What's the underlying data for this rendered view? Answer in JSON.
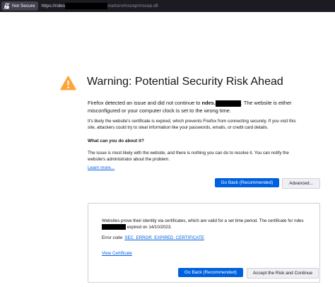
{
  "urlbar": {
    "security_label": "Not Secure",
    "url_prefix": "https://ndes",
    "url_suffix": "/certsrv/mscep/mscep.dll"
  },
  "warning": {
    "icon": "warning-triangle-icon",
    "title": "Warning: Potential Security Risk Ahead",
    "intro_before": "Firefox detected an issue and did not continue to ",
    "intro_host": "ndes.",
    "intro_after": ". The website is either misconfigured or your computer clock is set to the wrong time.",
    "detail": "It's likely the website's certificate is expired, which prevents Firefox from connecting securely. If you visit this site, attackers could try to steal information like your passwords, emails, or credit card details.",
    "subheading": "What can you do about it?",
    "advice": "The issue is most likely with the website, and there is nothing you can do to resolve it. You can notify the website's administrator about the problem.",
    "learn_more": "Learn more..."
  },
  "actions": {
    "go_back": "Go Back (Recommended)",
    "advanced": "Advanced..."
  },
  "advanced_panel": {
    "cert_text_before": "Websites prove their identity via certificates, which are valid for a set time period. The certificate for ndes",
    "cert_text_after": " expired on 14/10/2023.",
    "error_label": "Error code: ",
    "error_code": "SEC_ERROR_EXPIRED_CERTIFICATE",
    "view_certificate": "View Certificate",
    "go_back": "Go Back (Recommended)",
    "accept": "Accept the Risk and Continue"
  },
  "colors": {
    "accent": "#0061e0",
    "warning": "#ffa436",
    "urlbar_bg": "#1c1b22"
  }
}
